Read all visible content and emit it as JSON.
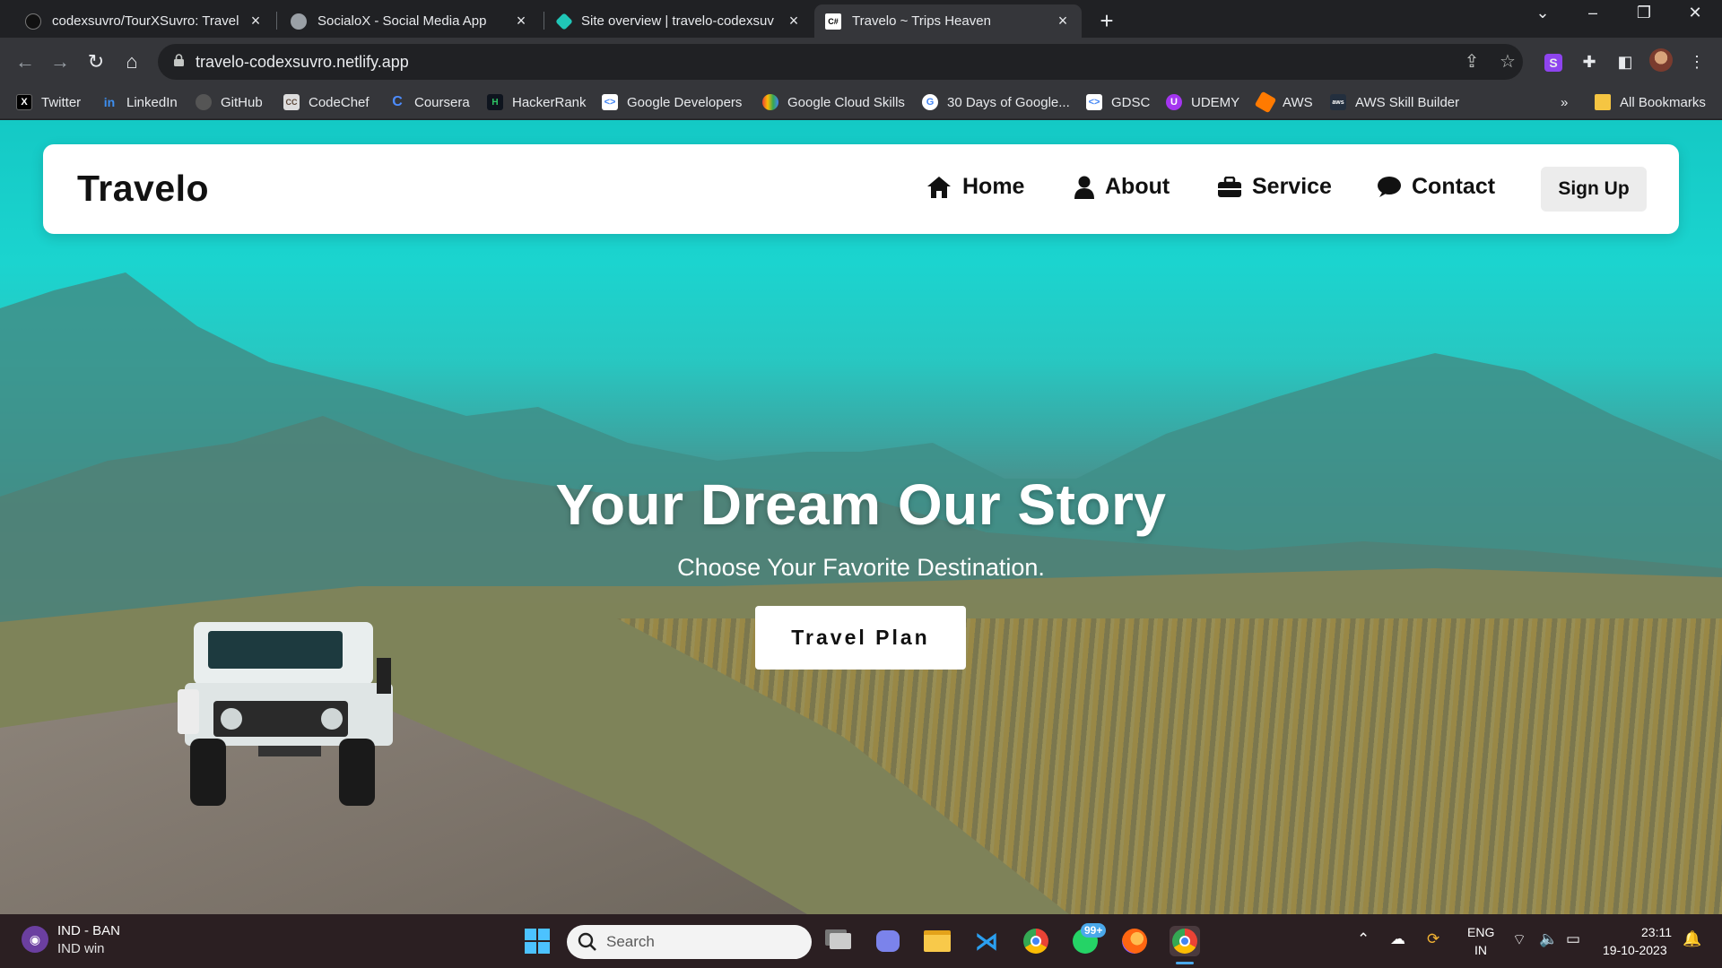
{
  "browser": {
    "tabs": [
      {
        "title": "codexsuvro/TourXSuvro: Travel a",
        "icon": "github-icon",
        "active": false
      },
      {
        "title": "SocialoX - Social Media App",
        "icon": "socialox-icon",
        "active": false
      },
      {
        "title": "Site overview | travelo-codexsuv",
        "icon": "netlify-icon",
        "active": false
      },
      {
        "title": "Travelo ~ Trips Heaven",
        "icon": "travelo-icon",
        "active": true
      }
    ],
    "url": "travelo-codexsuvro.netlify.app",
    "bookmarks": [
      {
        "label": "Twitter",
        "icon": "x-twitter-icon",
        "color": "#000000"
      },
      {
        "label": "LinkedIn",
        "icon": "linkedin-icon",
        "color": "#0a66c2"
      },
      {
        "label": "GitHub",
        "icon": "github-icon",
        "color": "#444444"
      },
      {
        "label": "CodeChef",
        "icon": "codechef-icon",
        "color": "#5b4638"
      },
      {
        "label": "Coursera",
        "icon": "coursera-icon",
        "color": "#0056d2"
      },
      {
        "label": "HackerRank",
        "icon": "hackerrank-icon",
        "color": "#1ba94c"
      },
      {
        "label": "Google Developers",
        "icon": "google-developers-icon",
        "color": "#4285f4"
      },
      {
        "label": "Google Cloud Skills",
        "icon": "google-cloud-icon",
        "color": "#ea4335"
      },
      {
        "label": "30 Days of Google...",
        "icon": "google-icon",
        "color": "#4285f4"
      },
      {
        "label": "GDSC",
        "icon": "gdsc-icon",
        "color": "#4285f4"
      },
      {
        "label": "UDEMY",
        "icon": "udemy-icon",
        "color": "#a435f0"
      },
      {
        "label": "AWS",
        "icon": "aws-icon",
        "color": "#ff9900"
      },
      {
        "label": "AWS Skill Builder",
        "icon": "aws-skill-builder-icon",
        "color": "#232f3e"
      }
    ],
    "more_bookmarks": "»",
    "all_bookmarks": "All Bookmarks"
  },
  "site": {
    "brand": "Travelo",
    "nav": [
      {
        "label": "Home",
        "icon": "home-icon"
      },
      {
        "label": "About",
        "icon": "user-icon"
      },
      {
        "label": "Service",
        "icon": "briefcase-icon"
      },
      {
        "label": "Contact",
        "icon": "chat-bubble-icon"
      }
    ],
    "signup": "Sign Up",
    "hero": {
      "title": "Your Dream Our Story",
      "subtitle": "Choose Your Favorite Destination.",
      "button": "Travel Plan"
    }
  },
  "taskbar": {
    "weather_line1": "IND - BAN",
    "weather_line2": "IND win",
    "search_placeholder": "Search",
    "whatsapp_badge": "99+",
    "lang_line1": "ENG",
    "lang_line2": "IN",
    "time": "23:11",
    "date": "19-10-2023"
  },
  "colors": {
    "sky": "#1bd4cf",
    "navbar_bg": "#ffffff",
    "chrome_dark": "#202124",
    "chrome_toolbar": "#35363a",
    "taskbar_bg": "#2b1f22"
  }
}
